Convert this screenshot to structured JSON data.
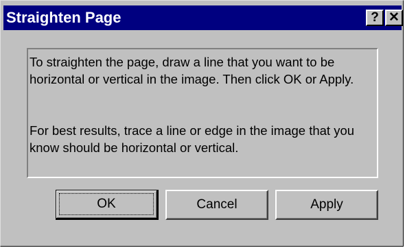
{
  "window": {
    "title": "Straighten Page",
    "help_label": "?",
    "close_label": "✕"
  },
  "message": {
    "paragraph_1": "To straighten the page, draw a line that you want to be horizontal or vertical in the image.  Then click OK or Apply.",
    "paragraph_2": "For best results, trace a line or edge in the image that you know should be horizontal or vertical."
  },
  "buttons": {
    "ok_label": "OK",
    "cancel_label": "Cancel",
    "apply_label": "Apply",
    "default_button": "OK"
  },
  "colors": {
    "titlebar": "#000080",
    "title_text": "#ffffff",
    "dialog_face": "#c0c0c0"
  },
  "icons": {
    "help": "help-icon",
    "close": "close-icon"
  }
}
